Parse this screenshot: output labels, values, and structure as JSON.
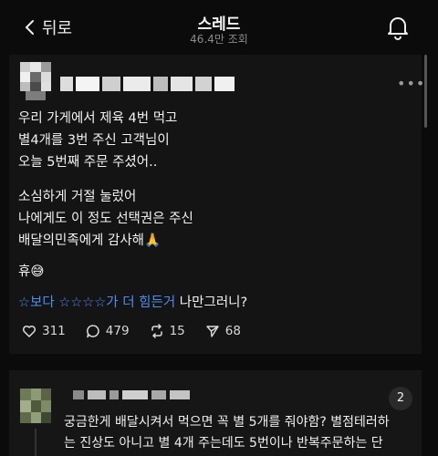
{
  "header": {
    "back_label": "뒤로",
    "title": "스레드",
    "subtitle": "46.4만 조회"
  },
  "post": {
    "lines_1": [
      "우리 가게에서 제육 4번 먹고",
      "별4개를 3번 주신 고객님이",
      "오늘 5번째 주문 주셨어.."
    ],
    "lines_2": [
      "소심하게 거절 눌렀어",
      "나에게도 이 정도 선택권은 주신",
      "배달의민족에게 감사해🙏"
    ],
    "line_3": "휴😅",
    "hashtag_1": "☆보다 ☆☆☆☆가 더  힘든거",
    "hashtag_2": " 나만그러니?",
    "actions": {
      "likes": "311",
      "comments": "479",
      "reposts": "15",
      "shares": "68"
    }
  },
  "reply": {
    "count": "2",
    "lines": [
      "궁금한게 배달시켜서 먹으면 꼭 별 5개를 줘야함? 별점테러하",
      "는 진상도 아니고 별 4개 주는데도 5번이나 반복주문하는 단"
    ]
  },
  "icons": {
    "back": "chevron-left-icon",
    "bell": "bell-icon",
    "more": "more-dots-icon",
    "like": "heart-icon",
    "comment": "comment-icon",
    "repost": "repost-icon",
    "share": "send-icon"
  }
}
